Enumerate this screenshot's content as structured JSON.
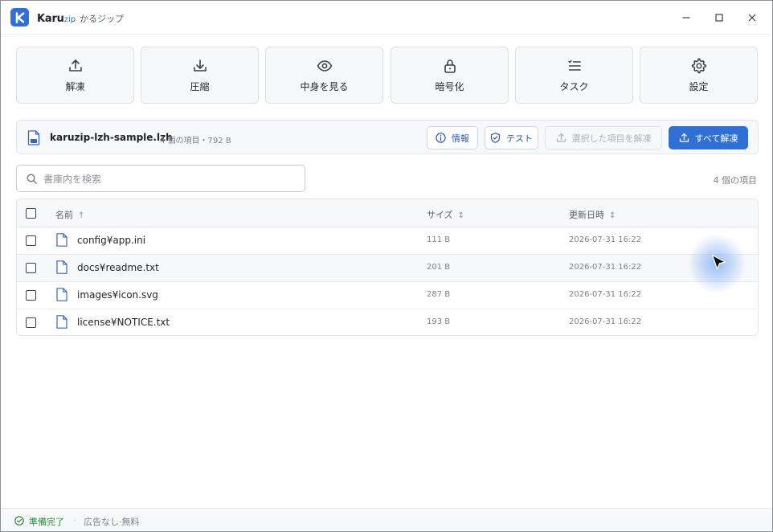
{
  "window": {
    "brand_main": "Karu",
    "brand_sub": "zip",
    "app_jp": "かるジップ",
    "controls": {
      "minimize": "minimize-icon",
      "maximize": "maximize-icon",
      "close": "close-icon"
    }
  },
  "toolbar": [
    {
      "label": "解凍",
      "icon": "upload-icon"
    },
    {
      "label": "圧縮",
      "icon": "download-icon"
    },
    {
      "label": "中身を見る",
      "icon": "eye-icon"
    },
    {
      "label": "暗号化",
      "icon": "lock-icon"
    },
    {
      "label": "タスク",
      "icon": "task-list-icon"
    },
    {
      "label": "設定",
      "icon": "gear-icon"
    }
  ],
  "archive": {
    "name": "karuzip-lzh-sample.lzh",
    "meta": "4 個の項目・792 B",
    "buttons": {
      "info": "情報",
      "test": "テスト",
      "extract_selected": "選択した項目を解凍",
      "extract_all": "すべて解凍"
    }
  },
  "search": {
    "placeholder": "書庫内を検索",
    "value": ""
  },
  "item_count": "4 個の項目",
  "table": {
    "columns": {
      "name": "名前",
      "name_sort": "↑",
      "size": "サイズ",
      "size_sort": "↕",
      "modified": "更新日時",
      "modified_sort": "↕"
    },
    "rows": [
      {
        "name": "config¥app.ini",
        "size": "111 B",
        "modified": "2026-07-31 16:22"
      },
      {
        "name": "docs¥readme.txt",
        "size": "201 B",
        "modified": "2026-07-31 16:22"
      },
      {
        "name": "images¥icon.svg",
        "size": "287 B",
        "modified": "2026-07-31 16:22"
      },
      {
        "name": "license¥NOTICE.txt",
        "size": "193 B",
        "modified": "2026-07-31 16:22"
      }
    ]
  },
  "status": {
    "ready": "準備完了",
    "separator": "·",
    "note": "広告なし·無料"
  },
  "colors": {
    "accent": "#2f6fd6",
    "success": "#2a8b3f",
    "muted": "#7a828c",
    "border": "#e3e6ea"
  }
}
